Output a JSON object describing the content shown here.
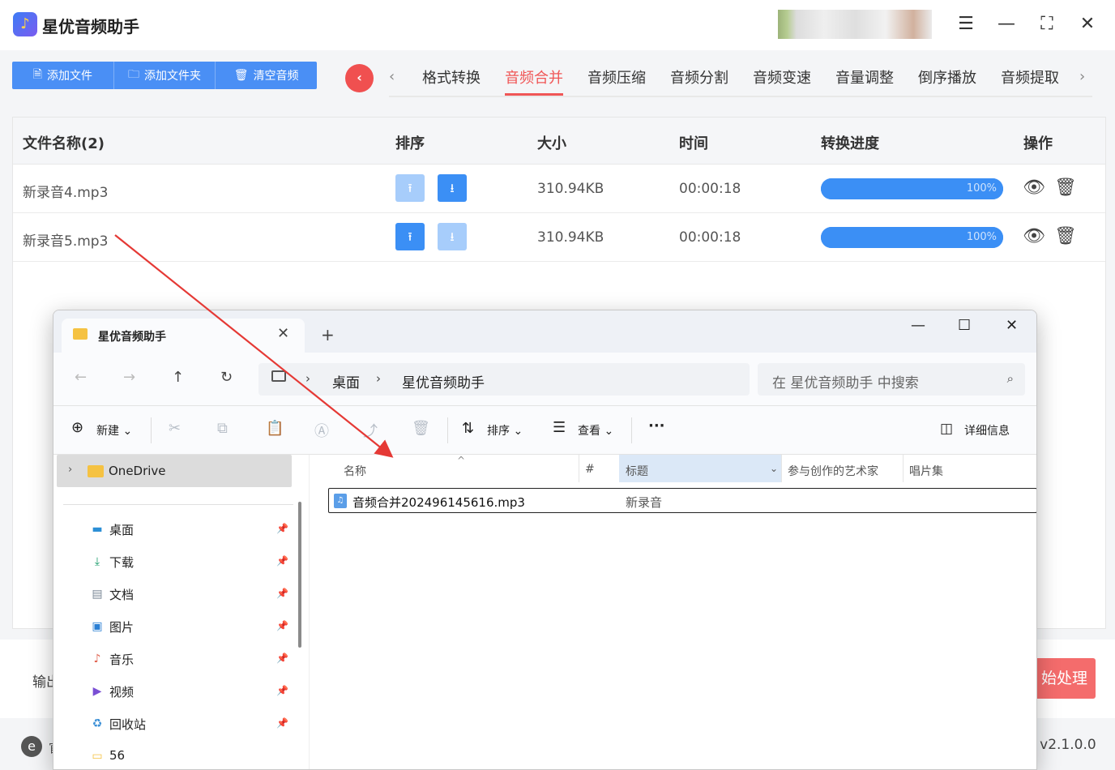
{
  "app": {
    "title": "星优音频助手",
    "logo_icon": "music-note-icon",
    "accent": "#4a8ff5",
    "active_color": "#f05656"
  },
  "toolbar": {
    "add_file": "添加文件",
    "add_folder": "添加文件夹",
    "clear": "清空音频"
  },
  "tabs": {
    "items": [
      "格式转换",
      "音频合并",
      "音频压缩",
      "音频分割",
      "音频变速",
      "音量调整",
      "倒序播放",
      "音频提取"
    ],
    "active_index": 1
  },
  "table": {
    "headers": {
      "name": "文件名称(2)",
      "sort": "排序",
      "size": "大小",
      "time": "时间",
      "progress": "转换进度",
      "ops": "操作"
    },
    "rows": [
      {
        "name": "新录音4.mp3",
        "size": "310.94KB",
        "time": "00:00:18",
        "progress_text": "100%",
        "progress": 1.0
      },
      {
        "name": "新录音5.mp3",
        "size": "310.94KB",
        "time": "00:00:18",
        "progress_text": "100%",
        "progress": 1.0
      }
    ]
  },
  "bottom": {
    "output_label": "输出",
    "start_button": "始处理"
  },
  "status": {
    "site_text": "官",
    "version": "v2.1.0.0"
  },
  "explorer": {
    "tab_title": "星优音频助手",
    "breadcrumb": [
      "桌面",
      "星优音频助手"
    ],
    "search_placeholder": "在 星优音频助手 中搜索",
    "commands": {
      "new": "新建",
      "sort": "排序",
      "view": "查看",
      "details": "详细信息"
    },
    "nav": {
      "onedrive": "OneDrive",
      "items": [
        {
          "label": "桌面",
          "icon": "desktop-icon"
        },
        {
          "label": "下载",
          "icon": "download-icon"
        },
        {
          "label": "文档",
          "icon": "document-icon"
        },
        {
          "label": "图片",
          "icon": "picture-icon"
        },
        {
          "label": "音乐",
          "icon": "music-icon"
        },
        {
          "label": "视频",
          "icon": "video-icon"
        },
        {
          "label": "回收站",
          "icon": "recycle-bin-icon"
        },
        {
          "label": "56",
          "icon": "folder-icon"
        }
      ]
    },
    "columns": {
      "name": "名称",
      "number": "#",
      "title": "标题",
      "artists": "参与创作的艺术家",
      "album": "唱片集"
    },
    "file": {
      "name": "音频合并202496145616.mp3",
      "title": "新录音"
    }
  }
}
